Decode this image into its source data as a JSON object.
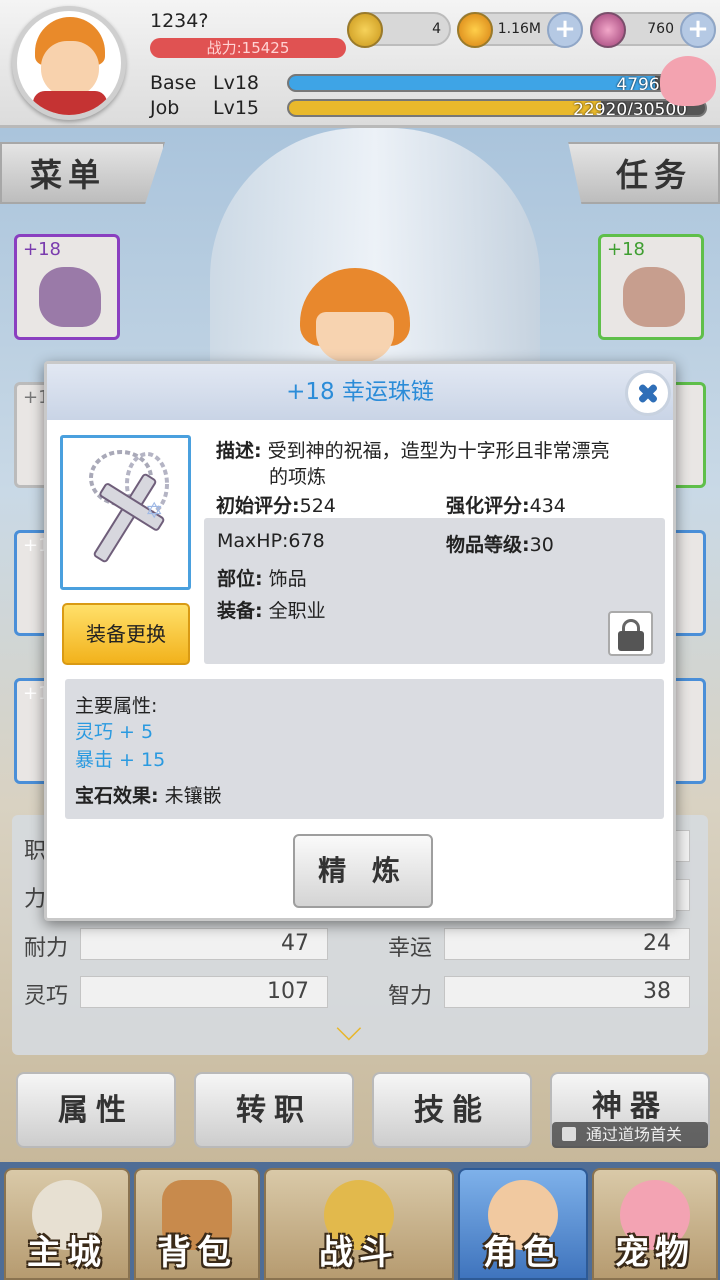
{
  "player": {
    "name": "1234?",
    "power": "战力:15425"
  },
  "resources": [
    {
      "icon": "zeny-coin-icon",
      "value": "4"
    },
    {
      "icon": "gold-coin-icon",
      "value": "1.16M"
    },
    {
      "icon": "crystal-gem-icon",
      "value": "760"
    }
  ],
  "levels": {
    "base": {
      "label": "Base",
      "lv": "Lv18",
      "text": "47964/5",
      "fill": 0.88,
      "color": "#3ea4e6"
    },
    "job": {
      "label": "Job",
      "lv": "Lv15",
      "text": "22920/30500",
      "fill": 0.75,
      "color": "#e9b92c"
    }
  },
  "side": {
    "menu": "菜单",
    "quest": "任务"
  },
  "slots": {
    "left_top": "+18",
    "right_top": "+18",
    "l2": "+1",
    "l3": "+1",
    "l4": "+1"
  },
  "stats": [
    {
      "label": "职",
      "value": ""
    },
    {
      "label": "力",
      "value": ""
    },
    {
      "label": "耐力",
      "value": "47"
    },
    {
      "label": "幸运",
      "value": "24"
    },
    {
      "label": "灵巧",
      "value": "107"
    },
    {
      "label": "智力",
      "value": "38"
    }
  ],
  "tabs": [
    "属性",
    "转职",
    "技能",
    "神器"
  ],
  "lock_note": "通过道场首关",
  "nav": [
    "主城",
    "背包",
    "战斗",
    "角色",
    "宠物"
  ],
  "dialog": {
    "title": "+18 幸运珠链",
    "desc_label": "描述:",
    "desc_text": "受到神的祝福，造型为十字形且非常漂亮",
    "desc_text2": "的项炼",
    "base_score_label": "初始评分:",
    "base_score": "524",
    "enh_score_label": "强化评分:",
    "enh_score": "434",
    "maxhp": "MaxHP:678",
    "item_level_label": "物品等级:",
    "item_level": "30",
    "part_label": "部位:",
    "part": "饰品",
    "equip_label": "装备:",
    "equip": "全职业",
    "swap_button": "装备更换",
    "main_attr_label": "主要属性:",
    "attrs": [
      "灵巧 + 5",
      "暴击 + 15"
    ],
    "gem_label": "宝石效果:",
    "gem": "未镶嵌",
    "refine_button": "精 炼"
  }
}
